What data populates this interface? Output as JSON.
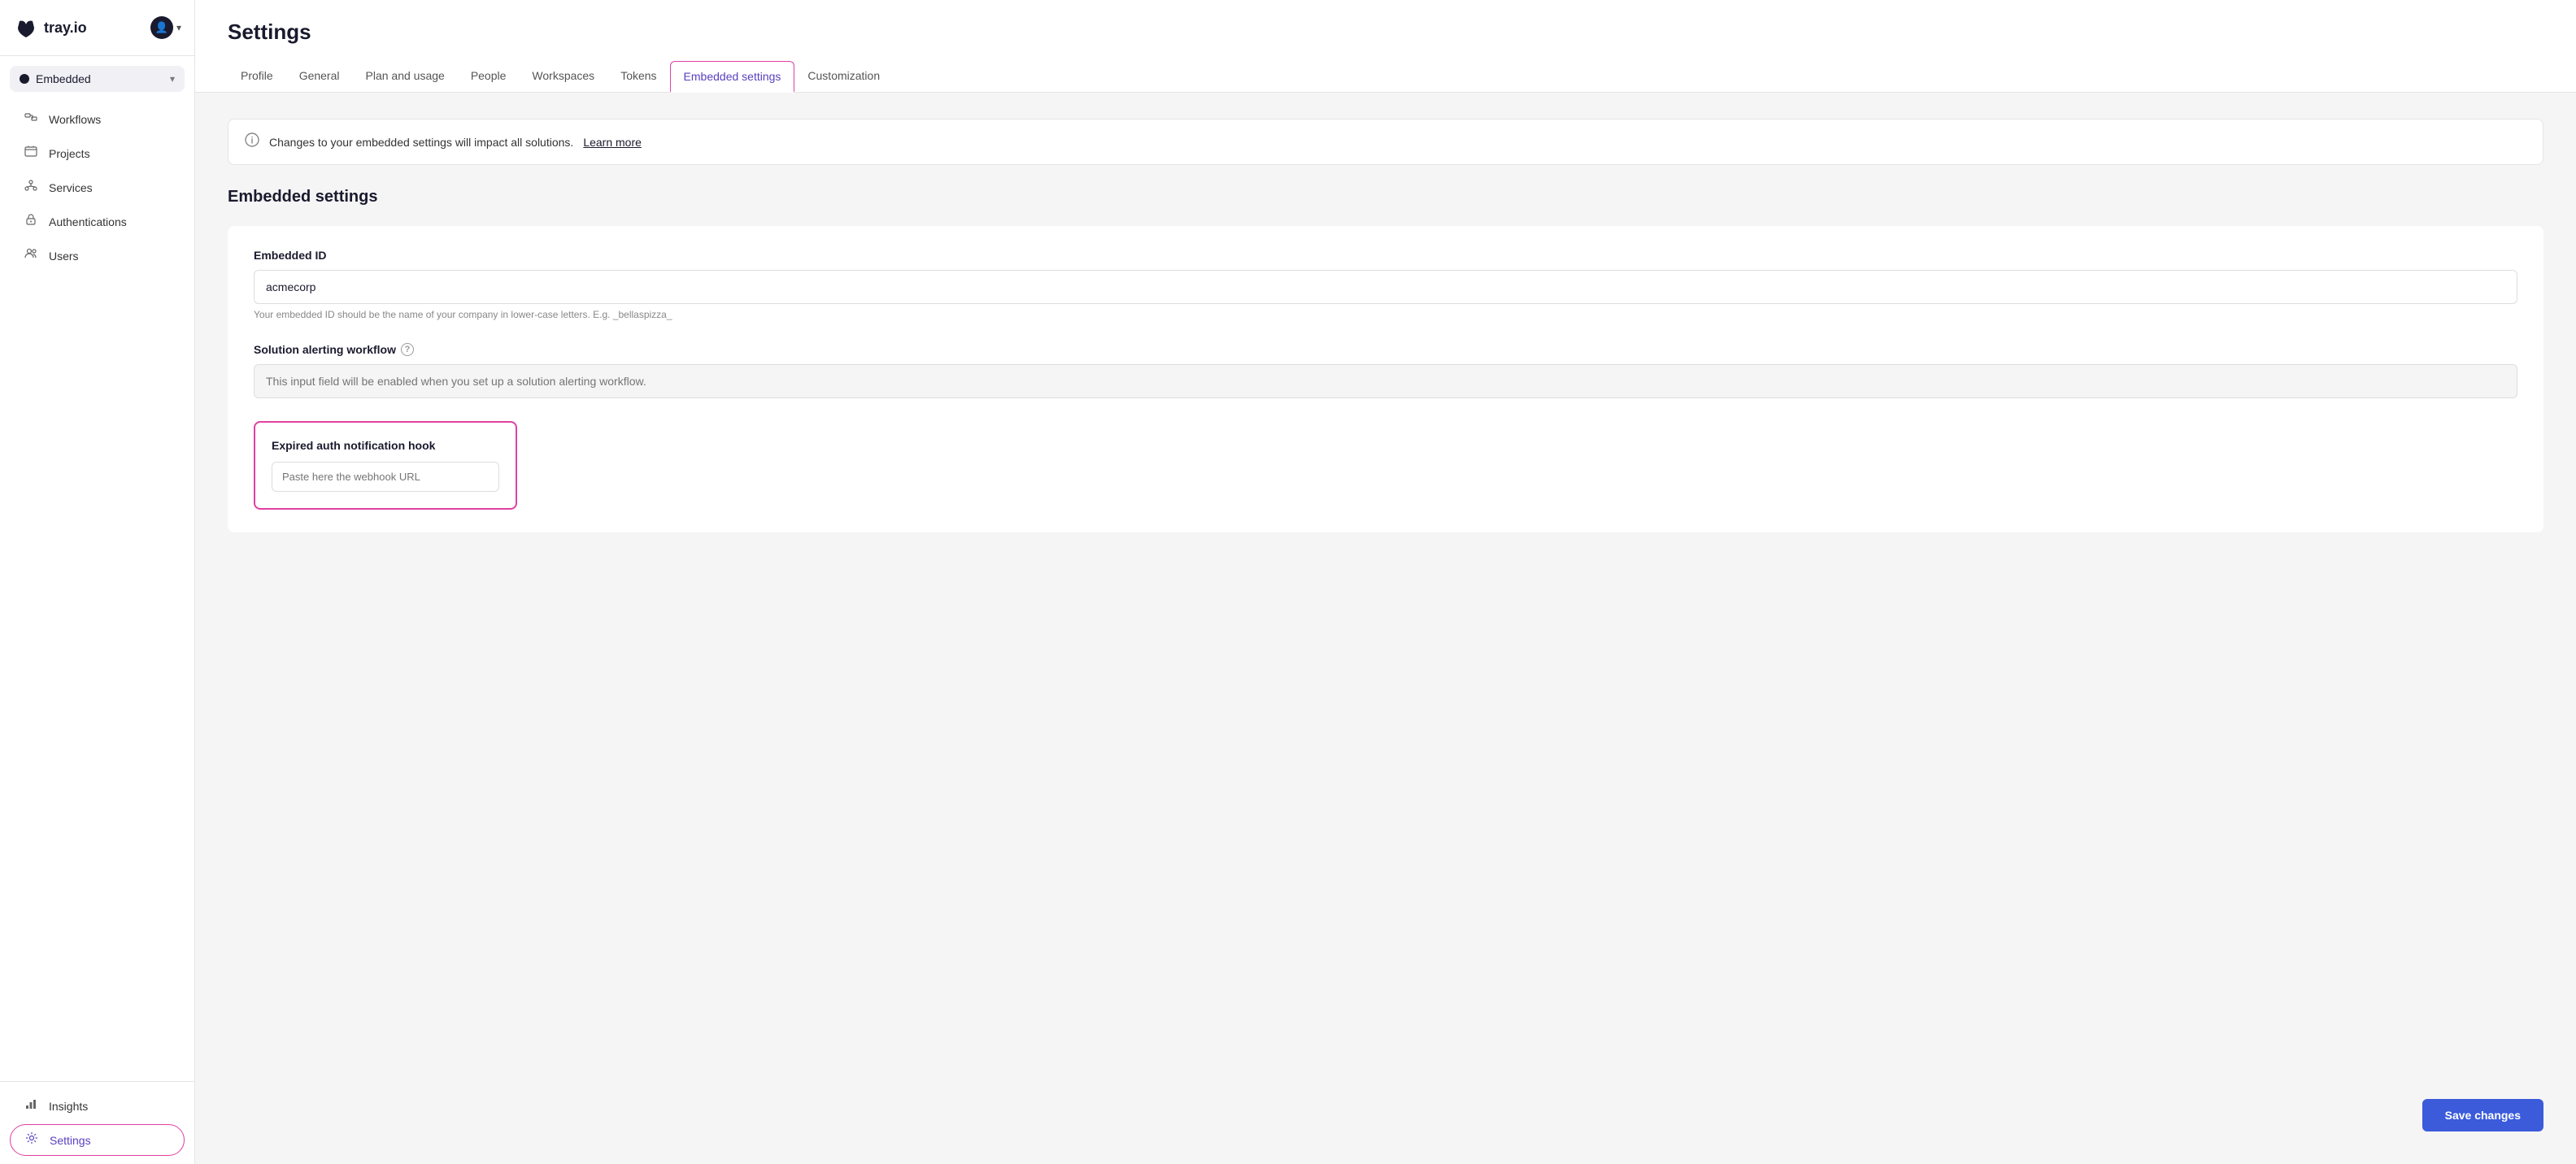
{
  "brand": {
    "logo_text": "tray.io"
  },
  "sidebar": {
    "workspace": {
      "name": "Embedded",
      "dot_color": "#1a1a2e"
    },
    "nav_items": [
      {
        "id": "workflows",
        "label": "Workflows",
        "icon": "⬡"
      },
      {
        "id": "projects",
        "label": "Projects",
        "icon": "📁"
      },
      {
        "id": "services",
        "label": "Services",
        "icon": "⚡"
      },
      {
        "id": "authentications",
        "label": "Authentications",
        "icon": "🔒"
      },
      {
        "id": "users",
        "label": "Users",
        "icon": "👥"
      }
    ],
    "footer_items": [
      {
        "id": "insights",
        "label": "Insights",
        "icon": "📊"
      },
      {
        "id": "settings",
        "label": "Settings",
        "icon": "⚙"
      }
    ]
  },
  "header": {
    "title": "Settings",
    "tabs": [
      {
        "id": "profile",
        "label": "Profile",
        "active": false
      },
      {
        "id": "general",
        "label": "General",
        "active": false
      },
      {
        "id": "plan-usage",
        "label": "Plan and usage",
        "active": false
      },
      {
        "id": "people",
        "label": "People",
        "active": false
      },
      {
        "id": "workspaces",
        "label": "Workspaces",
        "active": false
      },
      {
        "id": "tokens",
        "label": "Tokens",
        "active": false
      },
      {
        "id": "embedded-settings",
        "label": "Embedded settings",
        "active": true
      },
      {
        "id": "customization",
        "label": "Customization",
        "active": false
      }
    ]
  },
  "content": {
    "info_banner": {
      "text": "Changes to your embedded settings will impact all solutions.",
      "link_text": "Learn more"
    },
    "section_title": "Embedded settings",
    "fields": {
      "embedded_id": {
        "label": "Embedded ID",
        "value": "acmecorp",
        "hint": "Your embedded ID should be the name of your company in lower-case letters. E.g. _bellaspizza_"
      },
      "solution_alerting": {
        "label": "Solution alerting workflow",
        "placeholder": "This input field will be enabled when you set up a solution alerting workflow.",
        "disabled": true
      },
      "expired_auth": {
        "label": "Expired auth notification hook",
        "placeholder": "Paste here the webhook URL"
      }
    },
    "save_button": "Save changes"
  }
}
